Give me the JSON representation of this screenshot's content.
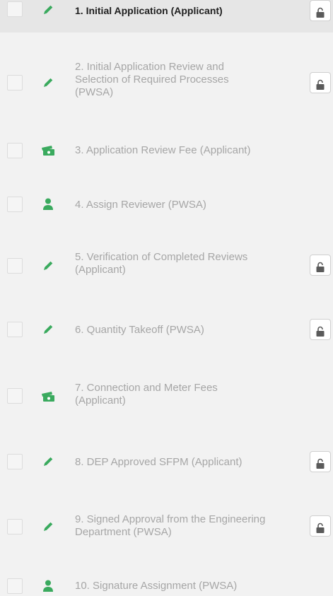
{
  "accent_color": "#3aaa5e",
  "steps": [
    {
      "label": "1. Initial Application (Applicant)",
      "icon": "pencil-icon",
      "locked": true,
      "active": true
    },
    {
      "label": "2. Initial Application Review and Selection of Required Processes (PWSA)",
      "icon": "pencil-icon",
      "locked": true,
      "active": false
    },
    {
      "label": "3. Application Review Fee (Applicant)",
      "icon": "money-icon",
      "locked": false,
      "active": false
    },
    {
      "label": "4. Assign Reviewer (PWSA)",
      "icon": "user-icon",
      "locked": false,
      "active": false
    },
    {
      "label": "5. Verification of Completed Reviews (Applicant)",
      "icon": "pencil-icon",
      "locked": true,
      "active": false
    },
    {
      "label": "6. Quantity Takeoff (PWSA)",
      "icon": "pencil-icon",
      "locked": true,
      "active": false
    },
    {
      "label": "7. Connection and Meter Fees (Applicant)",
      "icon": "money-icon",
      "locked": false,
      "active": false
    },
    {
      "label": "8. DEP Approved SFPM (Applicant)",
      "icon": "pencil-icon",
      "locked": true,
      "active": false
    },
    {
      "label": "9. Signed Approval from the Engineering Department (PWSA)",
      "icon": "pencil-icon",
      "locked": true,
      "active": false
    },
    {
      "label": "10. Signature Assignment (PWSA)",
      "icon": "user-icon",
      "locked": false,
      "active": false
    }
  ]
}
